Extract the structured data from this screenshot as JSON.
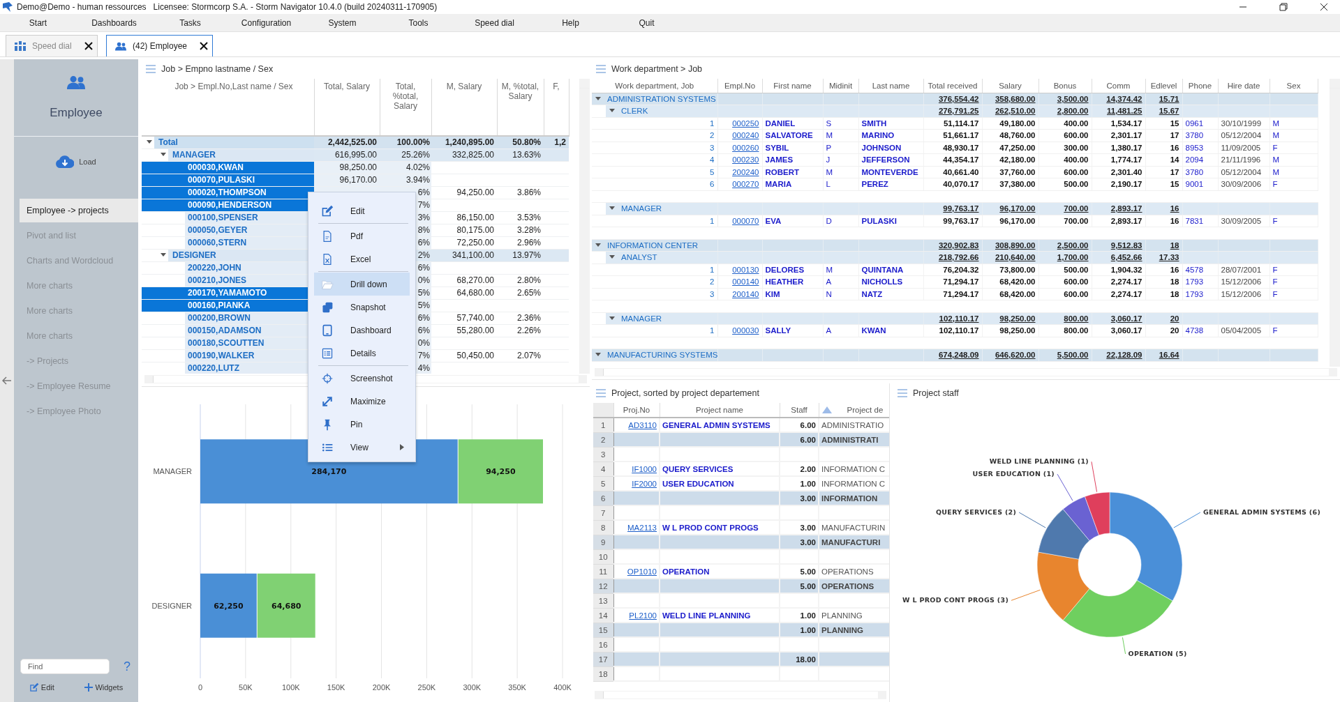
{
  "window": {
    "title": "Demo@Demo - human ressources",
    "licensee": "Licensee: Stormcorp S.A. -  Storm Navigator 10.4.0 (build 20240311-170905)"
  },
  "menu": [
    "Start",
    "Dashboards",
    "Tasks",
    "Configuration",
    "System",
    "Tools",
    "Speed dial",
    "Help",
    "Quit"
  ],
  "tabs": [
    {
      "label": "Speed dial",
      "selected": false
    },
    {
      "label": "(42) Employee",
      "selected": true
    }
  ],
  "sidebar": {
    "title": "Employee",
    "load": "Load",
    "items": [
      {
        "label": "Employee -> projects",
        "selected": true
      },
      {
        "label": "Pivot and list",
        "selected": false
      },
      {
        "label": "Charts and Wordcloud",
        "selected": false
      },
      {
        "label": "More charts",
        "selected": false
      },
      {
        "label": "More charts",
        "selected": false
      },
      {
        "label": "More charts",
        "selected": false
      },
      {
        "label": "-> Projects",
        "selected": false
      },
      {
        "label": "-> Employee Resume",
        "selected": false
      },
      {
        "label": "-> Employee Photo",
        "selected": false
      }
    ],
    "search": {
      "placeholder": "Find"
    },
    "help": "?",
    "edit": "Edit",
    "widgets": "Widgets"
  },
  "pivot": {
    "title": "Job > Empno lastname / Sex",
    "columns": [
      "Job > Empl.No,Last name / Sex",
      "Total, Salary",
      "Total, %total, Salary",
      "M, Salary",
      "M, %total, Salary",
      "F,"
    ],
    "rows": [
      {
        "label": "Total",
        "expanded": true,
        "total_salary": "2,442,525.00",
        "total_pct": "100.00%",
        "m_salary": "1,240,895.00",
        "m_pct": "50.80%",
        "column_6": "1,2",
        "children": [
          {
            "label": "MANAGER",
            "expanded": true,
            "total_salary": "616,995.00",
            "total_pct": "25.26%",
            "m_salary": "332,825.00",
            "m_pct": "13.63%",
            "children": [
              {
                "label": "000030,KWAN",
                "selected": true,
                "total_salary": "98,250.00",
                "total_pct": "4.02%"
              },
              {
                "label": "000070,PULASKI",
                "selected": true,
                "total_salary": "96,170.00",
                "total_pct": "3.94%"
              },
              {
                "label": "000020,THOMPSON",
                "selected": true,
                "total_pct": "6%",
                "m_salary": "94,250.00",
                "m_pct": "3.86%"
              },
              {
                "label": "000090,HENDERSON",
                "selected": true,
                "total_pct": "7%"
              },
              {
                "label": "000100,SPENSER",
                "selected": false,
                "total_pct": "3%",
                "m_salary": "86,150.00",
                "m_pct": "3.53%"
              },
              {
                "label": "000050,GEYER",
                "selected": false,
                "total_pct": "8%",
                "m_salary": "80,175.00",
                "m_pct": "3.28%"
              },
              {
                "label": "000060,STERN",
                "selected": false,
                "total_pct": "6%",
                "m_salary": "72,250.00",
                "m_pct": "2.96%"
              }
            ]
          },
          {
            "label": "DESIGNER",
            "expanded": true,
            "total_pct": "2%",
            "m_salary": "341,100.00",
            "m_pct": "13.97%",
            "children": [
              {
                "label": "200220,JOHN",
                "selected": false,
                "total_pct": "6%"
              },
              {
                "label": "000210,JONES",
                "selected": false,
                "total_pct": "0%",
                "m_salary": "68,270.00",
                "m_pct": "2.80%"
              },
              {
                "label": "200170,YAMAMOTO",
                "selected": true,
                "total_pct": "5%",
                "m_salary": "64,680.00",
                "m_pct": "2.65%"
              },
              {
                "label": "000160,PIANKA",
                "selected": true,
                "total_pct": "5%"
              },
              {
                "label": "000200,BROWN",
                "selected": false,
                "total_pct": "6%",
                "m_salary": "57,740.00",
                "m_pct": "2.36%"
              },
              {
                "label": "000150,ADAMSON",
                "selected": false,
                "total_pct": "6%",
                "m_salary": "55,280.00",
                "m_pct": "2.26%"
              },
              {
                "label": "000180,SCOUTTEN",
                "selected": false,
                "total_pct": "0%"
              },
              {
                "label": "000190,WALKER",
                "selected": false,
                "total_pct": "7%",
                "m_salary": "50,450.00",
                "m_pct": "2.07%"
              },
              {
                "label": "000220,LUTZ",
                "selected": false,
                "total_pct": "4%"
              }
            ]
          }
        ]
      }
    ]
  },
  "context_menu": {
    "items": [
      {
        "kind": "item",
        "label": "Edit",
        "selected": false,
        "has_submenu": false
      },
      {
        "kind": "separator"
      },
      {
        "kind": "item",
        "label": "Pdf",
        "selected": false,
        "has_submenu": false
      },
      {
        "kind": "item",
        "label": "Excel",
        "selected": false,
        "has_submenu": false
      },
      {
        "kind": "separator"
      },
      {
        "kind": "item",
        "label": "Drill down",
        "selected": true,
        "has_submenu": false
      },
      {
        "kind": "item",
        "label": "Snapshot",
        "selected": false,
        "has_submenu": false
      },
      {
        "kind": "item",
        "label": "Dashboard",
        "selected": false,
        "has_submenu": false
      },
      {
        "kind": "item",
        "label": "Details",
        "selected": false,
        "has_submenu": false
      },
      {
        "kind": "separator"
      },
      {
        "kind": "item",
        "label": "Screenshot",
        "selected": false,
        "has_submenu": false
      },
      {
        "kind": "item",
        "label": "Maximize",
        "selected": false,
        "has_submenu": false
      },
      {
        "kind": "item",
        "label": "Pin",
        "selected": false,
        "has_submenu": false
      },
      {
        "kind": "item",
        "label": "View",
        "selected": false,
        "has_submenu": true
      }
    ]
  },
  "bar_chart": {
    "chart_data": {
      "type": "bar",
      "orientation": "horizontal",
      "stacked": true,
      "grid": true,
      "value_labels": [
        [
          "284,170",
          "62,250"
        ],
        [
          "94,250",
          "64,680"
        ]
      ],
      "categories": [
        "MANAGER",
        "DESIGNER"
      ],
      "series": [
        {
          "color": "#4a8fd6",
          "values": [
            284170,
            62250
          ]
        },
        {
          "color": "#80d173",
          "values": [
            94250,
            64680
          ]
        }
      ],
      "xlim": [
        0,
        400000
      ],
      "xticks": [
        {
          "value": 0,
          "label": "0"
        },
        {
          "value": 50000,
          "label": "50K"
        },
        {
          "value": 100000,
          "label": "100K"
        },
        {
          "value": 150000,
          "label": "150K"
        },
        {
          "value": 200000,
          "label": "200K"
        },
        {
          "value": 250000,
          "label": "250K"
        },
        {
          "value": 300000,
          "label": "300K"
        },
        {
          "value": 350000,
          "label": "350K"
        },
        {
          "value": 400000,
          "label": "400K"
        }
      ]
    }
  },
  "work_table": {
    "title": "Work department > Job",
    "columns": [
      "Work department, Job",
      "Empl.No",
      "First name",
      "Midinit",
      "Last name",
      "Total received",
      "Salary",
      "Bonus",
      "Comm",
      "Edlevel",
      "Phone",
      "Hire date",
      "Sex"
    ],
    "groups": [
      {
        "label": "ADMINISTRATION SYSTEMS",
        "expanded": true,
        "totals": [
          "376,554.42",
          "358,680.00",
          "3,500.00",
          "14,374.42",
          "15.71"
        ],
        "children": [
          {
            "label": "CLERK",
            "expanded": true,
            "totals": [
              "276,791.25",
              "262,510.00",
              "2,800.00",
              "11,481.25",
              "15.67"
            ],
            "rows": [
              {
                "index": "1",
                "empl_no": "000250",
                "first_name": "DANIEL",
                "midinit": "S",
                "last_name": "SMITH",
                "total_received": "51,114.17",
                "salary": "49,180.00",
                "bonus": "400.00",
                "comm": "1,534.17",
                "edlevel": "15",
                "phone": "0961",
                "hire_date": "30/10/1999",
                "sex": "M"
              },
              {
                "index": "2",
                "empl_no": "000240",
                "first_name": "SALVATORE",
                "midinit": "M",
                "last_name": "MARINO",
                "total_received": "51,661.17",
                "salary": "48,760.00",
                "bonus": "600.00",
                "comm": "2,301.17",
                "edlevel": "17",
                "phone": "3780",
                "hire_date": "05/12/2004",
                "sex": "M"
              },
              {
                "index": "3",
                "empl_no": "000260",
                "first_name": "SYBIL",
                "midinit": "P",
                "last_name": "JOHNSON",
                "total_received": "48,930.17",
                "salary": "47,250.00",
                "bonus": "300.00",
                "comm": "1,380.17",
                "edlevel": "16",
                "phone": "8953",
                "hire_date": "11/09/2005",
                "sex": "F"
              },
              {
                "index": "4",
                "empl_no": "000230",
                "first_name": "JAMES",
                "midinit": "J",
                "last_name": "JEFFERSON",
                "total_received": "44,354.17",
                "salary": "42,180.00",
                "bonus": "400.00",
                "comm": "1,774.17",
                "edlevel": "14",
                "phone": "2094",
                "hire_date": "21/11/1996",
                "sex": "M"
              },
              {
                "index": "5",
                "empl_no": "200240",
                "first_name": "ROBERT",
                "midinit": "M",
                "last_name": "MONTEVERDE",
                "total_received": "40,661.40",
                "salary": "37,760.00",
                "bonus": "600.00",
                "comm": "2,301.40",
                "edlevel": "17",
                "phone": "3780",
                "hire_date": "05/12/2004",
                "sex": "M"
              },
              {
                "index": "6",
                "empl_no": "000270",
                "first_name": "MARIA",
                "midinit": "L",
                "last_name": "PEREZ",
                "total_received": "40,070.17",
                "salary": "37,380.00",
                "bonus": "500.00",
                "comm": "2,190.17",
                "edlevel": "15",
                "phone": "9001",
                "hire_date": "30/09/2006",
                "sex": "F"
              }
            ]
          },
          {
            "label": "MANAGER",
            "expanded": true,
            "totals": [
              "99,763.17",
              "96,170.00",
              "700.00",
              "2,893.17",
              "16"
            ],
            "rows": [
              {
                "index": "1",
                "empl_no": "000070",
                "first_name": "EVA",
                "midinit": "D",
                "last_name": "PULASKI",
                "total_received": "99,763.17",
                "salary": "96,170.00",
                "bonus": "700.00",
                "comm": "2,893.17",
                "edlevel": "16",
                "phone": "7831",
                "hire_date": "30/09/2005",
                "sex": "F"
              }
            ]
          }
        ]
      },
      {
        "label": "INFORMATION CENTER",
        "expanded": true,
        "totals": [
          "320,902.83",
          "308,890.00",
          "2,500.00",
          "9,512.83",
          "18"
        ],
        "children": [
          {
            "label": "ANALYST",
            "expanded": true,
            "totals": [
              "218,792.66",
              "210,640.00",
              "1,700.00",
              "6,452.66",
              "17.33"
            ],
            "rows": [
              {
                "index": "1",
                "empl_no": "000130",
                "first_name": "DELORES",
                "midinit": "M",
                "last_name": "QUINTANA",
                "total_received": "76,204.32",
                "salary": "73,800.00",
                "bonus": "500.00",
                "comm": "1,904.32",
                "edlevel": "16",
                "phone": "4578",
                "hire_date": "28/07/2001",
                "sex": "F"
              },
              {
                "index": "2",
                "empl_no": "000140",
                "first_name": "HEATHER",
                "midinit": "A",
                "last_name": "NICHOLLS",
                "total_received": "71,294.17",
                "salary": "68,420.00",
                "bonus": "600.00",
                "comm": "2,274.17",
                "edlevel": "18",
                "phone": "1793",
                "hire_date": "15/12/2006",
                "sex": "F"
              },
              {
                "index": "3",
                "empl_no": "200140",
                "first_name": "KIM",
                "midinit": "N",
                "last_name": "NATZ",
                "total_received": "71,294.17",
                "salary": "68,420.00",
                "bonus": "600.00",
                "comm": "2,274.17",
                "edlevel": "18",
                "phone": "1793",
                "hire_date": "15/12/2006",
                "sex": "F"
              }
            ]
          },
          {
            "label": "MANAGER",
            "expanded": true,
            "totals": [
              "102,110.17",
              "98,250.00",
              "800.00",
              "3,060.17",
              "20"
            ],
            "rows": [
              {
                "index": "1",
                "empl_no": "000030",
                "first_name": "SALLY",
                "midinit": "A",
                "last_name": "KWAN",
                "total_received": "102,110.17",
                "salary": "98,250.00",
                "bonus": "800.00",
                "comm": "3,060.17",
                "edlevel": "20",
                "phone": "4738",
                "hire_date": "05/04/2005",
                "sex": "F"
              }
            ]
          }
        ]
      },
      {
        "label": "MANUFACTURING SYSTEMS",
        "expanded": true,
        "totals": [
          "674,248.09",
          "646,620.00",
          "5,500.00",
          "22,128.09",
          "16.64"
        ]
      }
    ]
  },
  "projects": {
    "title": "Project, sorted by project departement",
    "columns": [
      "Proj.No",
      "Project name",
      "Staff",
      "Project de"
    ],
    "rows": [
      {
        "number": "1",
        "kind": "item",
        "proj_no": "AD3110",
        "name": "GENERAL ADMIN SYSTEMS",
        "staff": "6.00",
        "department": "ADMINISTRATIO"
      },
      {
        "number": "2",
        "kind": "subtotal",
        "staff": "6.00",
        "department": "ADMINISTRATI"
      },
      {
        "number": "3",
        "kind": "blank"
      },
      {
        "number": "4",
        "kind": "item",
        "proj_no": "IF1000",
        "name": "QUERY SERVICES",
        "staff": "2.00",
        "department": "INFORMATION C"
      },
      {
        "number": "5",
        "kind": "item",
        "proj_no": "IF2000",
        "name": "USER EDUCATION",
        "staff": "1.00",
        "department": "INFORMATION C"
      },
      {
        "number": "6",
        "kind": "subtotal",
        "staff": "3.00",
        "department": "INFORMATION"
      },
      {
        "number": "7",
        "kind": "blank"
      },
      {
        "number": "8",
        "kind": "item",
        "proj_no": "MA2113",
        "name": "W L PROD CONT PROGS",
        "staff": "3.00",
        "department": "MANUFACTURIN"
      },
      {
        "number": "9",
        "kind": "subtotal",
        "staff": "3.00",
        "department": "MANUFACTURI"
      },
      {
        "number": "10",
        "kind": "blank"
      },
      {
        "number": "11",
        "kind": "item",
        "proj_no": "OP1010",
        "name": "OPERATION",
        "staff": "5.00",
        "department": "OPERATIONS"
      },
      {
        "number": "12",
        "kind": "subtotal",
        "staff": "5.00",
        "department": "OPERATIONS"
      },
      {
        "number": "13",
        "kind": "blank"
      },
      {
        "number": "14",
        "kind": "item",
        "proj_no": "PL2100",
        "name": "WELD LINE PLANNING",
        "staff": "1.00",
        "department": "PLANNING"
      },
      {
        "number": "15",
        "kind": "subtotal",
        "staff": "1.00",
        "department": "PLANNING"
      },
      {
        "number": "16",
        "kind": "blank"
      },
      {
        "number": "17",
        "kind": "subtotal",
        "staff": "18.00"
      },
      {
        "number": "18",
        "kind": "blank"
      }
    ]
  },
  "project_staff": {
    "title": "Project staff",
    "chart_data": {
      "type": "donut",
      "categories": [
        "GENERAL ADMIN SYSTEMS (6)",
        "OPERATION (5)",
        "W L PROD CONT PROGS (3)",
        "QUERY SERVICES (2)",
        "USER EDUCATION (1)",
        "WELD LINE PLANNING (1)"
      ],
      "values": [
        6,
        5,
        3,
        2,
        1,
        1
      ],
      "colors": [
        "#4a8fd8",
        "#6fcf5f",
        "#e8852e",
        "#4f79ad",
        "#6a62d2",
        "#df3f5c"
      ]
    }
  }
}
